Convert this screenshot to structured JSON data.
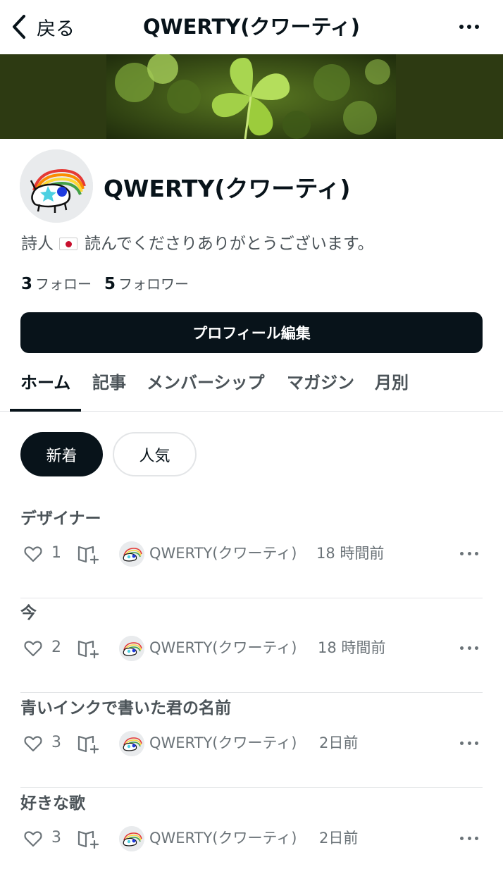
{
  "nav": {
    "back_label": "戻る",
    "title": "QWERTY(クワーティ)"
  },
  "profile": {
    "name": "QWERTY(クワーティ)",
    "bio_prefix": "詩人",
    "bio_text": "読んでくださりありがとうございます。",
    "follow_count": "3",
    "follow_label": "フォロー",
    "follower_count": "5",
    "follower_label": "フォロワー",
    "edit_button": "プロフィール編集"
  },
  "tabs": [
    {
      "label": "ホーム",
      "active": true
    },
    {
      "label": "記事",
      "active": false
    },
    {
      "label": "メンバーシップ",
      "active": false
    },
    {
      "label": "マガジン",
      "active": false
    },
    {
      "label": "月別",
      "active": false
    }
  ],
  "filters": {
    "new_label": "新着",
    "popular_label": "人気"
  },
  "articles": [
    {
      "title": "デザイナー",
      "likes": "1",
      "author": "QWERTY(クワーティ)",
      "time": "18 時間前"
    },
    {
      "title": "今",
      "likes": "2",
      "author": "QWERTY(クワーティ)",
      "time": "18 時間前"
    },
    {
      "title": "青いインクで書いた君の名前",
      "likes": "3",
      "author": "QWERTY(クワーティ)",
      "time": "2日前"
    },
    {
      "title": "好きな歌",
      "likes": "3",
      "author": "QWERTY(クワーティ)",
      "time": "2日前"
    }
  ],
  "colors": {
    "primary": "#08131a",
    "muted_text": "#4b5358",
    "banner_bg": "#2d3a12",
    "clover_green": "#9ccc3c"
  },
  "icons": {
    "back": "chevron-left-icon",
    "more": "ellipsis-icon",
    "like": "heart-icon",
    "magazine": "magazine-add-icon"
  }
}
